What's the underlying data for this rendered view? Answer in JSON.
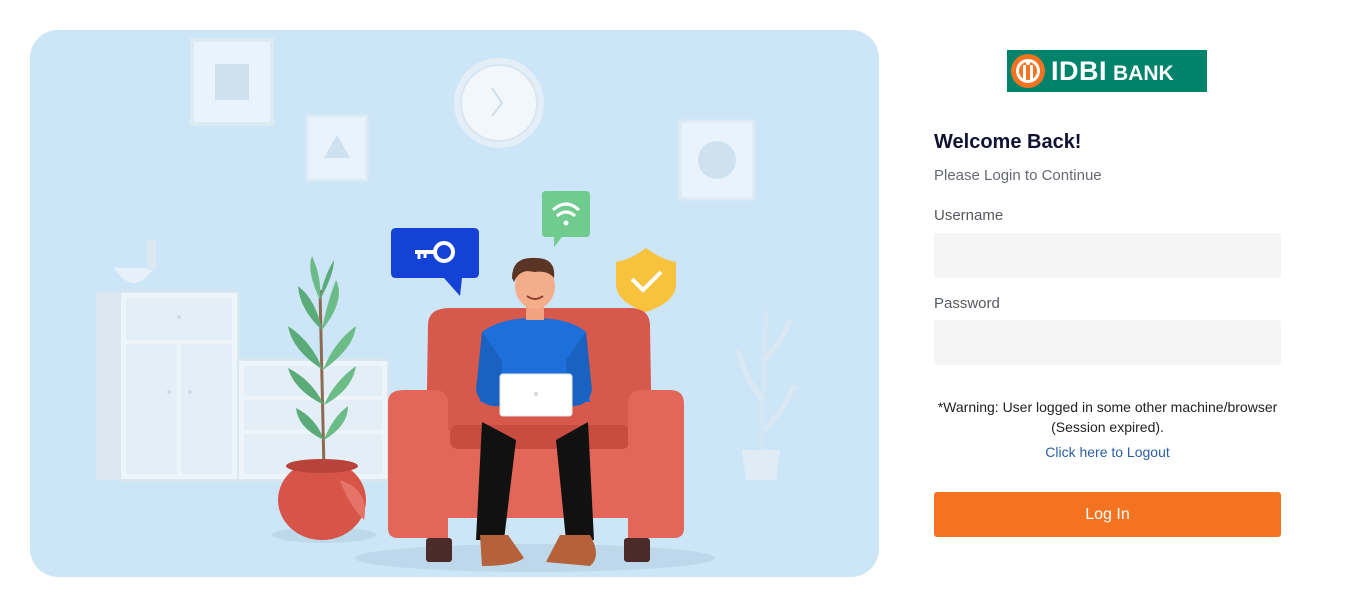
{
  "brand": {
    "logo_word1": "IDBI",
    "logo_word2": "BANK",
    "logo_bg_color": "#00836b",
    "logo_mark_color": "#f47321"
  },
  "login": {
    "heading": "Welcome Back!",
    "subheading": "Please Login to Continue",
    "username_label": "Username",
    "username_value": "",
    "password_label": "Password",
    "password_value": "",
    "warning_line1": "*Warning: User logged in some other machine/browser",
    "warning_line2": "(Session expired).",
    "logout_link": "Click here to Logout",
    "submit_label": "Log In"
  },
  "illustration": {
    "icons": [
      "key-icon",
      "wifi-icon",
      "shield-check-icon",
      "clock-icon",
      "laptop-icon",
      "plant-icon"
    ]
  },
  "colors": {
    "accent": "#f47321",
    "illustration_bg": "#cde6f7",
    "link": "#2b5fa3"
  }
}
